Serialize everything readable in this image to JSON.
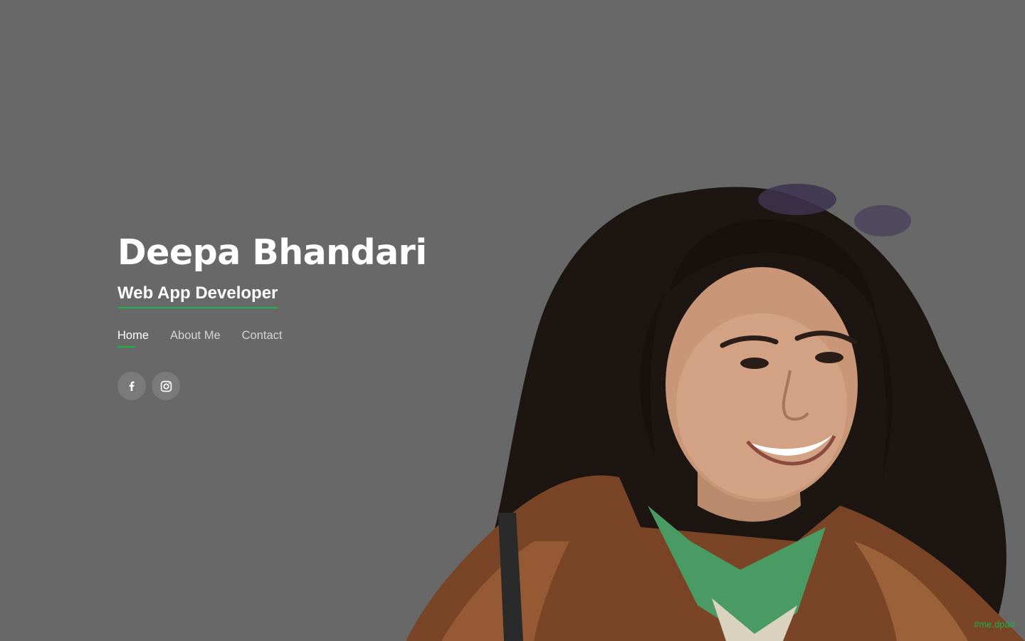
{
  "profile": {
    "name": "Deepa Bhandari",
    "role": "Web App Developer"
  },
  "nav": {
    "items": [
      {
        "label": "Home",
        "active": true
      },
      {
        "label": "About Me",
        "active": false
      },
      {
        "label": "Contact",
        "active": false
      }
    ]
  },
  "social": {
    "icons": [
      "facebook-icon",
      "instagram-icon"
    ]
  },
  "footer": {
    "watermark": "#me.dpa#"
  },
  "colors": {
    "background": "#686868",
    "accent": "#19b24b",
    "text": "#ffffff",
    "muted_text": "#d4d4d4"
  }
}
